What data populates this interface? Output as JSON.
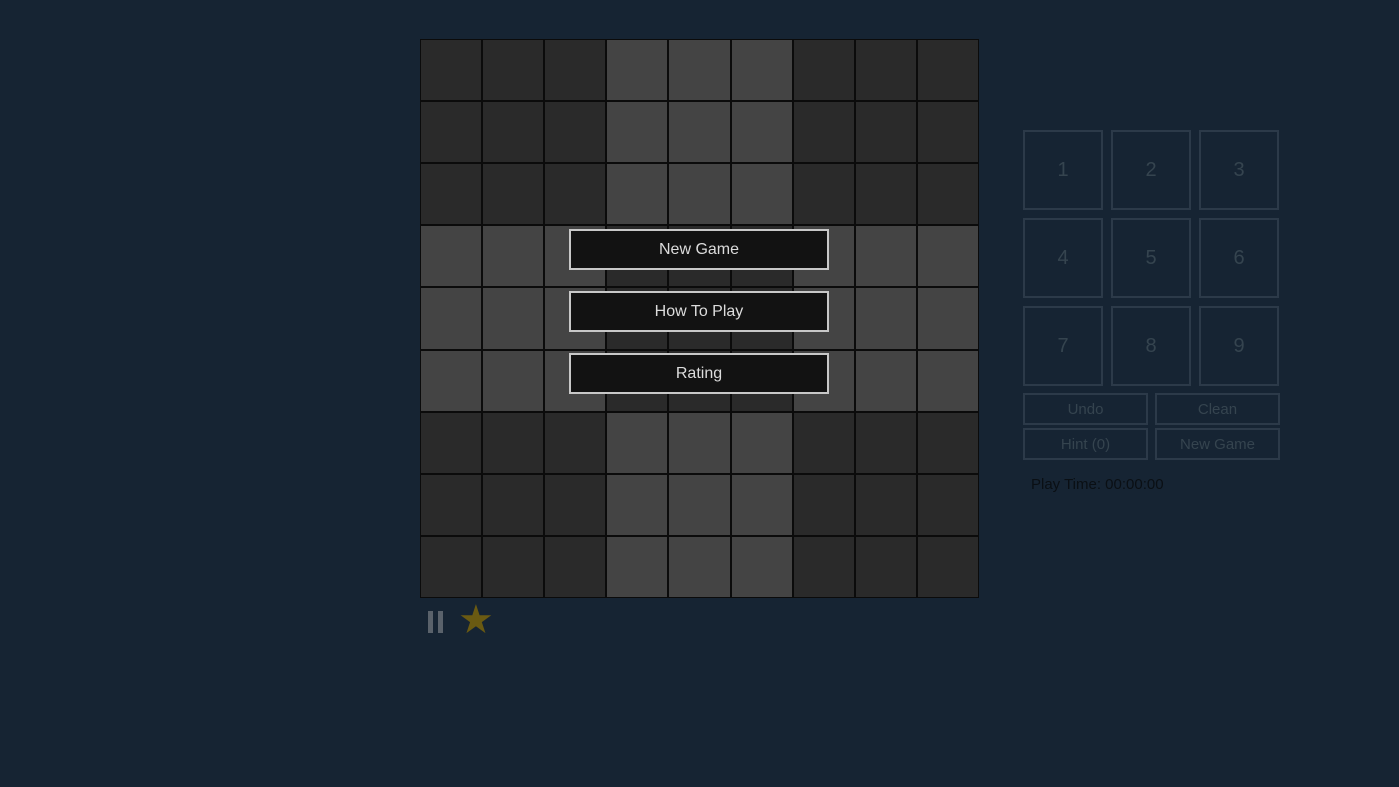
{
  "board": {
    "size": 9,
    "shading": [
      [
        0,
        0,
        0,
        1,
        1,
        1,
        0,
        0,
        0
      ],
      [
        0,
        0,
        0,
        1,
        1,
        1,
        0,
        0,
        0
      ],
      [
        0,
        0,
        0,
        1,
        1,
        1,
        0,
        0,
        0
      ],
      [
        1,
        1,
        1,
        0,
        0,
        0,
        1,
        1,
        1
      ],
      [
        1,
        1,
        1,
        0,
        0,
        0,
        1,
        1,
        1
      ],
      [
        1,
        1,
        1,
        0,
        0,
        0,
        1,
        1,
        1
      ],
      [
        0,
        0,
        0,
        1,
        1,
        1,
        0,
        0,
        0
      ],
      [
        0,
        0,
        0,
        1,
        1,
        1,
        0,
        0,
        0
      ],
      [
        0,
        0,
        0,
        1,
        1,
        1,
        0,
        0,
        0
      ]
    ],
    "colors": {
      "dark": "#2a2a2a",
      "light": "#444444"
    }
  },
  "menu": {
    "new_game": "New Game",
    "how_to_play": "How To Play",
    "rating": "Rating"
  },
  "numpad": {
    "numbers": [
      "1",
      "2",
      "3",
      "4",
      "5",
      "6",
      "7",
      "8",
      "9"
    ],
    "undo": "Undo",
    "clean": "Clean",
    "hint": "Hint (0)",
    "new_game": "New Game"
  },
  "status": {
    "play_time": "Play Time: 00:00:00"
  },
  "icons": {
    "pause": "pause-icon",
    "star": "star-icon",
    "star_glyph": "★"
  }
}
